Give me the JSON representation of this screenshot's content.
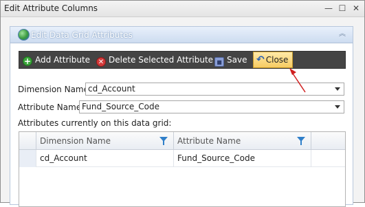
{
  "window": {
    "title": "Edit Attribute Columns",
    "minimize_glyph": "—",
    "maximize_glyph": "☐",
    "close_glyph": "✕"
  },
  "panel": {
    "title": "Edit Data Grid Attributes",
    "icon": "globe-icon",
    "collapse_glyph": "︽"
  },
  "toolbar": {
    "add_label": "Add Attribute",
    "delete_label": "Delete Selected Attribute",
    "save_label": "Save",
    "close_label": "Close",
    "add_glyph": "+",
    "delete_glyph": "✕",
    "save_glyph": "■",
    "close_glyph": "↶"
  },
  "form": {
    "dimension_label": "Dimension Name",
    "dimension_value": "cd_Account",
    "attribute_label": "Attribute Name",
    "attribute_value": "Fund_Source_Code",
    "grid_caption": "Attributes currently on this data grid:"
  },
  "grid": {
    "columns": [
      "Dimension Name",
      "Attribute Name"
    ],
    "rows": [
      [
        "cd_Account",
        "Fund_Source_Code"
      ]
    ]
  },
  "colors": {
    "toolbar_bg": "#444444",
    "close_highlight": "#f7cc62",
    "panel_header": "#cddcf0",
    "annotation_arrow": "#d02020"
  }
}
